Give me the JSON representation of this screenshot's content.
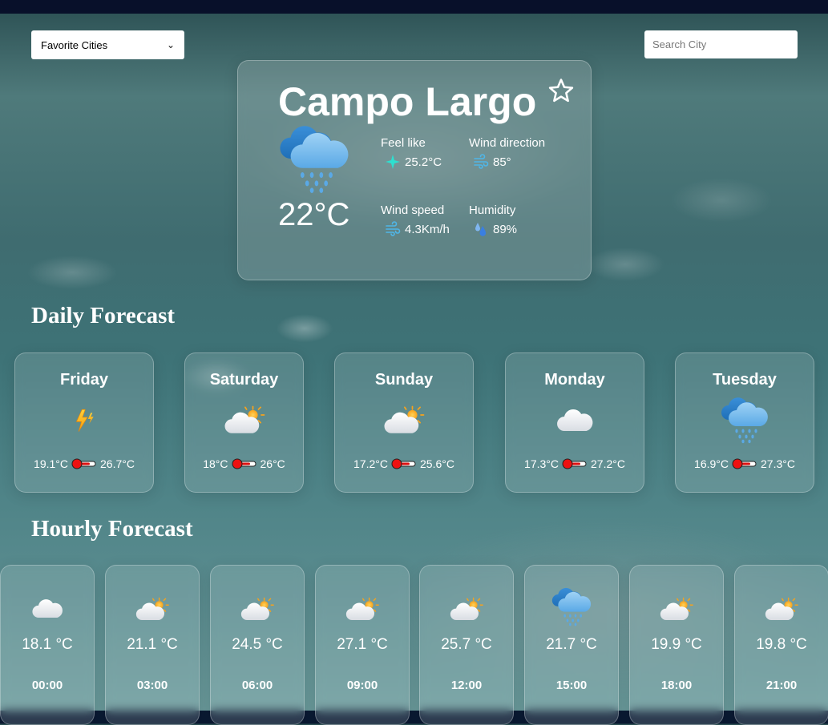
{
  "header": {
    "favorites_select": {
      "selected": "Favorite Cities"
    },
    "search": {
      "placeholder": "Search City",
      "value": ""
    }
  },
  "current": {
    "city": "Campo Largo",
    "favorite_icon": "star-outline-icon",
    "weather_icon": "cloud-rain-icon",
    "temperature": "22°C",
    "feels_like": {
      "label": "Feel like",
      "value": "25.2°C",
      "icon": "sparkle-icon"
    },
    "wind_direction": {
      "label": "Wind direction",
      "value": "85°",
      "icon": "wind-icon"
    },
    "wind_speed": {
      "label": "Wind speed",
      "value": "4.3Km/h",
      "icon": "wind-icon"
    },
    "humidity": {
      "label": "Humidity",
      "value": "89%",
      "icon": "droplets-icon"
    }
  },
  "daily": {
    "title": "Daily Forecast",
    "days": [
      {
        "name": "Friday",
        "icon": "thunderstorm-icon",
        "min": "19.1°C",
        "max": "26.7°C"
      },
      {
        "name": "Saturday",
        "icon": "partly-cloudy-icon",
        "min": "18°C",
        "max": "26°C"
      },
      {
        "name": "Sunday",
        "icon": "partly-cloudy-icon",
        "min": "17.2°C",
        "max": "25.6°C"
      },
      {
        "name": "Monday",
        "icon": "cloud-icon",
        "min": "17.3°C",
        "max": "27.2°C"
      },
      {
        "name": "Tuesday",
        "icon": "cloud-rain-icon",
        "min": "16.9°C",
        "max": "27.3°C"
      }
    ]
  },
  "hourly": {
    "title": "Hourly Forecast",
    "hours": [
      {
        "time": "00:00",
        "temp": "18.1 °C",
        "icon": "cloud-icon"
      },
      {
        "time": "03:00",
        "temp": "21.1 °C",
        "icon": "partly-cloudy-icon"
      },
      {
        "time": "06:00",
        "temp": "24.5 °C",
        "icon": "partly-cloudy-icon"
      },
      {
        "time": "09:00",
        "temp": "27.1 °C",
        "icon": "partly-cloudy-icon"
      },
      {
        "time": "12:00",
        "temp": "25.7 °C",
        "icon": "partly-cloudy-icon"
      },
      {
        "time": "15:00",
        "temp": "21.7 °C",
        "icon": "cloud-rain-icon"
      },
      {
        "time": "18:00",
        "temp": "19.9 °C",
        "icon": "partly-cloudy-icon"
      },
      {
        "time": "21:00",
        "temp": "19.8 °C",
        "icon": "partly-cloudy-icon"
      }
    ]
  }
}
